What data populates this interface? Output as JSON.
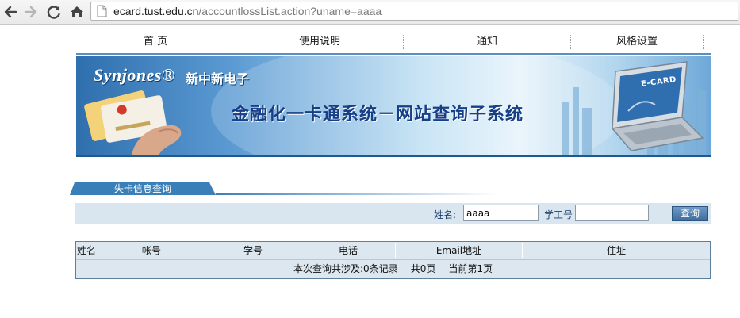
{
  "browser": {
    "url_host": "ecard.tust.edu.cn",
    "url_path": "/accountlossList.action?uname=aaaa"
  },
  "topmenu": {
    "items": [
      {
        "label": "首  页"
      },
      {
        "label": "使用说明"
      },
      {
        "label": "通知"
      },
      {
        "label": "风格设置"
      }
    ]
  },
  "banner": {
    "brand": "Synjones®",
    "brand_cn": "新中新电子",
    "title": "金融化一卡通系统－网站查询子系统",
    "card_label": "E-CARD"
  },
  "section": {
    "title": "失卡信息查询"
  },
  "search": {
    "name_label": "姓名:",
    "name_value": "aaaa",
    "id_label": "学工号",
    "id_value": "",
    "button_label": "查询"
  },
  "table": {
    "headers": [
      "姓名",
      "帐号",
      "学号",
      "电话",
      "Email地址",
      "住址"
    ],
    "summary": {
      "records": "本次查询共涉及:0条记录",
      "pages": "共0页",
      "current": "当前第1页"
    }
  },
  "colors": {
    "accent": "#3a7fb8",
    "panel": "#d9e6ef",
    "banner_title": "#173f86"
  }
}
